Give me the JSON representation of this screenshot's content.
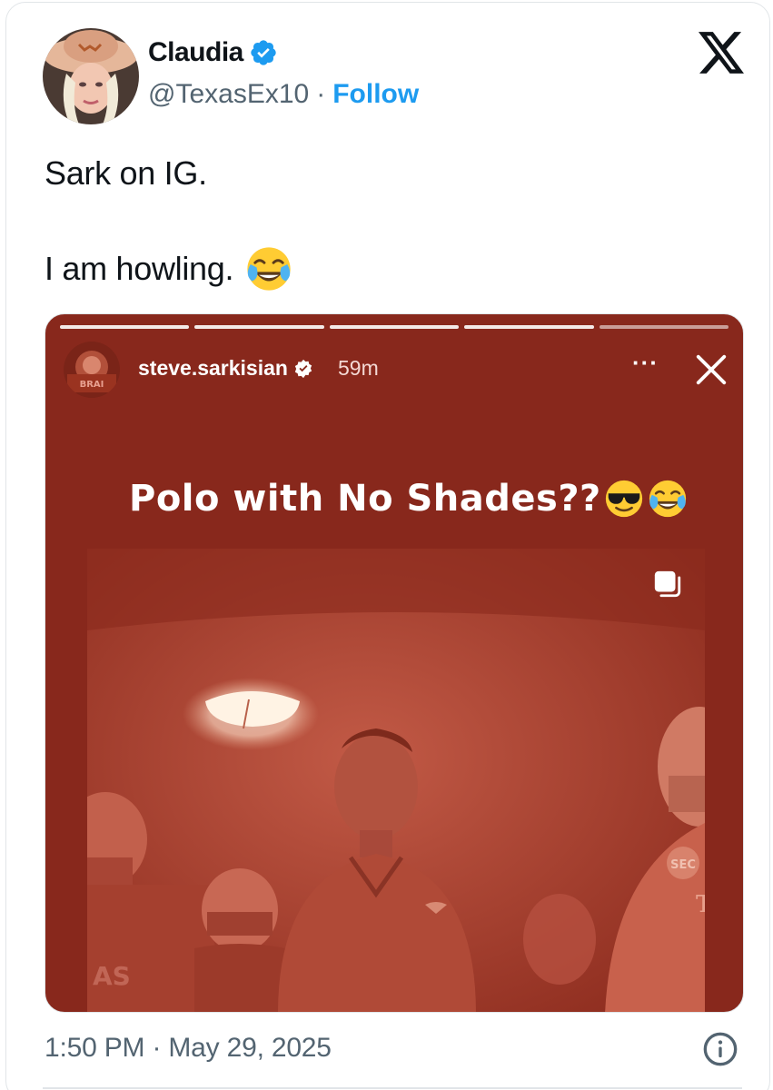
{
  "author": {
    "display_name": "Claudia",
    "handle": "@TexasEx10",
    "separator": "·",
    "follow_label": "Follow",
    "verified": true
  },
  "tweet": {
    "lines": [
      "Sark on IG.",
      "I am howling."
    ],
    "emoji": "face-with-tears-of-joy"
  },
  "story": {
    "progress_segments": 5,
    "completed_segments": 4,
    "username": "steve.sarkisian",
    "verified": true,
    "time_ago": "59m",
    "more_label": "···",
    "caption": "Polo with No Shades??",
    "caption_emojis": [
      "smiling-face-with-sunglasses",
      "face-with-tears-of-joy"
    ],
    "accent_color": "#88281c"
  },
  "footer": {
    "timestamp": "1:50 PM · May 29, 2025"
  },
  "colors": {
    "link_blue": "#1d9bf0",
    "secondary_text": "#536471",
    "border": "#e1e5e8"
  }
}
